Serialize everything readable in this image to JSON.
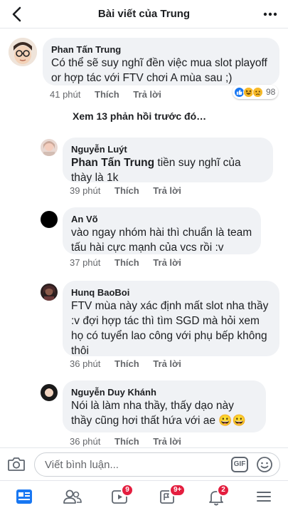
{
  "header": {
    "title": "Bài viết của Trung"
  },
  "comments": [
    {
      "name": "Phan Tấn Trung",
      "text": "Có thể sẽ suy nghĩ đền việc mua slot playoff or hợp tác với FTV chơi A mùa sau ;)",
      "time": "41 phút",
      "like": "Thích",
      "reply": "Trả lời",
      "reactions": {
        "count": "98",
        "icons": [
          "like-icon",
          "haha-icon",
          "sad-icon"
        ]
      }
    }
  ],
  "view_more": "Xem 13 phản hồi trước đó…",
  "replies": [
    {
      "name": "Nguyễn Luýt",
      "mention": "Phan Tấn Trung",
      "text": " tiền suy nghĩ của thày là 1k",
      "time": "39 phút",
      "like": "Thích",
      "reply": "Trả lời"
    },
    {
      "name": "An Võ",
      "text": "vào ngay nhóm hài thì chuẩn là team tấu hài cực mạnh của vcs rồi :v",
      "time": "37 phút",
      "like": "Thích",
      "reply": "Trả lời"
    },
    {
      "name": "Hunq BaoBoi",
      "text": "FTV mùa này xác định mất slot nha thầy :v đợi hợp tác thì tìm SGD mà hỏi xem họ có tuyển lao công với phụ bếp không thôi",
      "time": "36 phút",
      "like": "Thích",
      "reply": "Trả lời"
    },
    {
      "name": "Nguyễn Duy Khánh",
      "text": "Nói là làm nha thầy, thấy dạo này thầy cũng hơi thất hứa với ae ",
      "emoji": "😀😀",
      "time": "36 phút",
      "like": "Thích",
      "reply": "Trả lời"
    }
  ],
  "composer": {
    "placeholder": "Viết bình luận...",
    "gif": "GIF"
  },
  "tabbar": {
    "items": [
      {
        "name": "news-feed-icon",
        "badge": ""
      },
      {
        "name": "friends-icon",
        "badge": ""
      },
      {
        "name": "watch-icon",
        "badge": "9"
      },
      {
        "name": "pages-icon",
        "badge": "9+"
      },
      {
        "name": "notifications-icon",
        "badge": "2"
      },
      {
        "name": "menu-icon",
        "badge": ""
      }
    ]
  },
  "colors": {
    "accent": "#1877f2",
    "badge": "#e41e3f",
    "bubble": "#f0f2f5"
  }
}
